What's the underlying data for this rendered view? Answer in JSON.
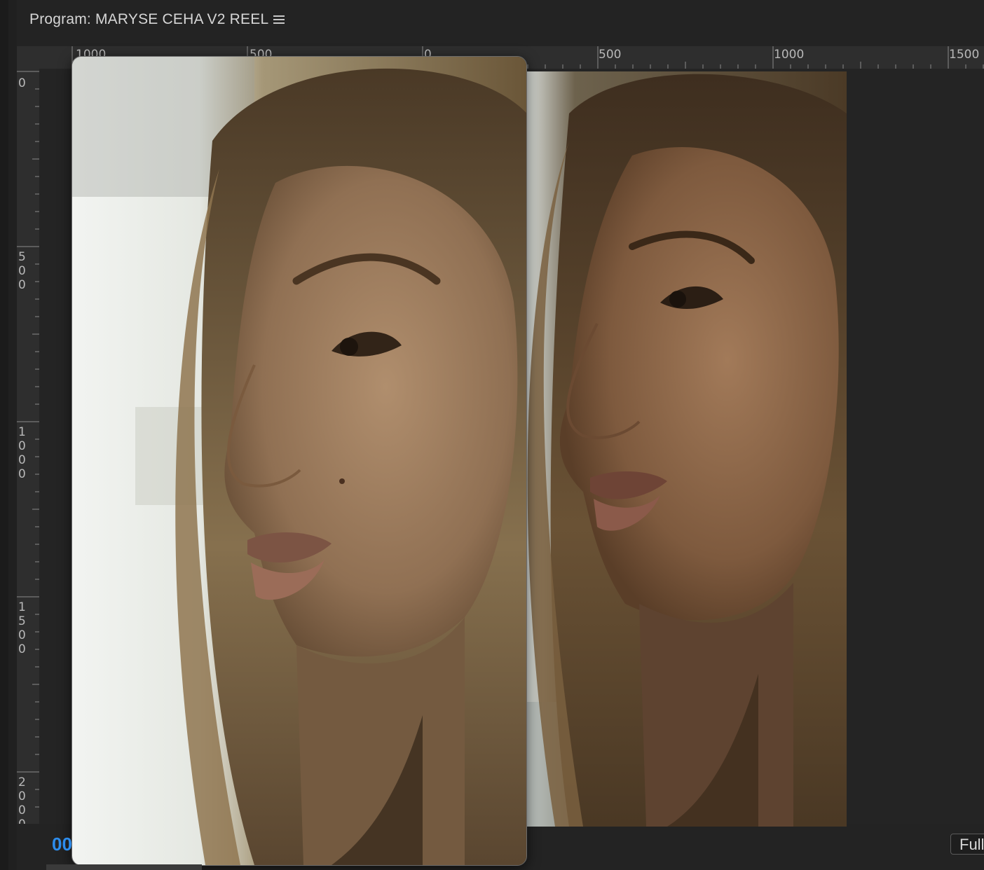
{
  "panel": {
    "title": "Program: MARYSE CEHA V2 REEL",
    "menu_icon": "hamburger-menu-icon"
  },
  "rulers": {
    "horizontal_labels": [
      "1000",
      "500",
      "0",
      "500",
      "1000",
      "1500"
    ],
    "vertical_labels": [
      "0",
      "500",
      "1000",
      "1500",
      "2000"
    ]
  },
  "footer": {
    "timecode": "00",
    "fit_label": "Full"
  },
  "colors": {
    "panel_bg": "#232323",
    "ruler_bg": "#2e2e2e",
    "timecode": "#2d8ceb"
  }
}
